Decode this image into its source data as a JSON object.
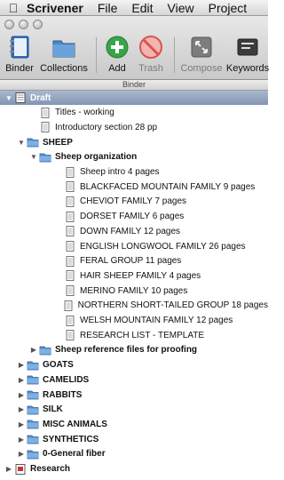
{
  "menubar": {
    "apple": "",
    "app_name": "Scrivener",
    "items": [
      "File",
      "Edit",
      "View",
      "Project"
    ]
  },
  "toolbar": {
    "binder": "Binder",
    "collections": "Collections",
    "add": "Add",
    "trash": "Trash",
    "compose": "Compose",
    "keywords": "Keywords"
  },
  "binder_header": "Binder",
  "outline": [
    {
      "label": "Draft",
      "level": 0,
      "icon": "draft-icon",
      "toggle": "open",
      "selected": true
    },
    {
      "label": "Titles - working",
      "level": 2,
      "icon": "document-icon",
      "toggle": "none"
    },
    {
      "label": "Introductory section 28 pp",
      "level": 2,
      "icon": "document-icon",
      "toggle": "none"
    },
    {
      "label": "SHEEP",
      "level": 1,
      "icon": "folder-icon",
      "toggle": "open",
      "bold": true
    },
    {
      "label": "Sheep organization",
      "level": 2,
      "icon": "folder-icon",
      "toggle": "open",
      "bold": true
    },
    {
      "label": "Sheep intro 4 pages",
      "level": 3,
      "icon": "document-icon",
      "toggle": "none"
    },
    {
      "label": "BLACKFACED MOUNTAIN FAMILY 9 pages",
      "level": 3,
      "icon": "document-icon",
      "toggle": "none"
    },
    {
      "label": "CHEVIOT FAMILY 7 pages",
      "level": 3,
      "icon": "document-icon",
      "toggle": "none"
    },
    {
      "label": "DORSET FAMILY 6 pages",
      "level": 3,
      "icon": "document-icon",
      "toggle": "none"
    },
    {
      "label": "DOWN FAMILY 12 pages",
      "level": 3,
      "icon": "document-icon",
      "toggle": "none"
    },
    {
      "label": "ENGLISH LONGWOOL FAMILY 26 pages",
      "level": 3,
      "icon": "document-icon",
      "toggle": "none"
    },
    {
      "label": "FERAL GROUP 11 pages",
      "level": 3,
      "icon": "document-icon",
      "toggle": "none"
    },
    {
      "label": "HAIR SHEEP FAMILY 4 pages",
      "level": 3,
      "icon": "document-icon",
      "toggle": "none"
    },
    {
      "label": "MERINO FAMILY 10 pages",
      "level": 3,
      "icon": "document-icon",
      "toggle": "none"
    },
    {
      "label": "NORTHERN SHORT-TAILED GROUP 18 pages",
      "level": 3,
      "icon": "document-icon",
      "toggle": "none"
    },
    {
      "label": "WELSH MOUNTAIN FAMILY 12 pages",
      "level": 3,
      "icon": "document-icon",
      "toggle": "none"
    },
    {
      "label": "RESEARCH LIST - TEMPLATE",
      "level": 3,
      "icon": "document-icon",
      "toggle": "none"
    },
    {
      "label": "Sheep reference files for proofing",
      "level": 2,
      "icon": "folder-icon",
      "toggle": "closed",
      "bold": true
    },
    {
      "label": "GOATS",
      "level": 1,
      "icon": "folder-icon",
      "toggle": "closed",
      "bold": true
    },
    {
      "label": "CAMELIDS",
      "level": 1,
      "icon": "folder-icon",
      "toggle": "closed",
      "bold": true
    },
    {
      "label": "RABBITS",
      "level": 1,
      "icon": "folder-icon",
      "toggle": "closed",
      "bold": true
    },
    {
      "label": "SILK",
      "level": 1,
      "icon": "folder-icon",
      "toggle": "closed",
      "bold": true
    },
    {
      "label": "MISC ANIMALS",
      "level": 1,
      "icon": "folder-icon",
      "toggle": "closed",
      "bold": true
    },
    {
      "label": "SYNTHETICS",
      "level": 1,
      "icon": "folder-icon",
      "toggle": "closed",
      "bold": true
    },
    {
      "label": "0-General fiber",
      "level": 1,
      "icon": "folder-icon",
      "toggle": "closed",
      "bold": true
    },
    {
      "label": "Research",
      "level": 0,
      "icon": "research-icon",
      "toggle": "closed",
      "bold": true
    }
  ],
  "colors": {
    "selection": "#8196b3",
    "folder": "#5a8fc9",
    "add_green": "#3aa548",
    "trash_red": "#d9534f"
  }
}
